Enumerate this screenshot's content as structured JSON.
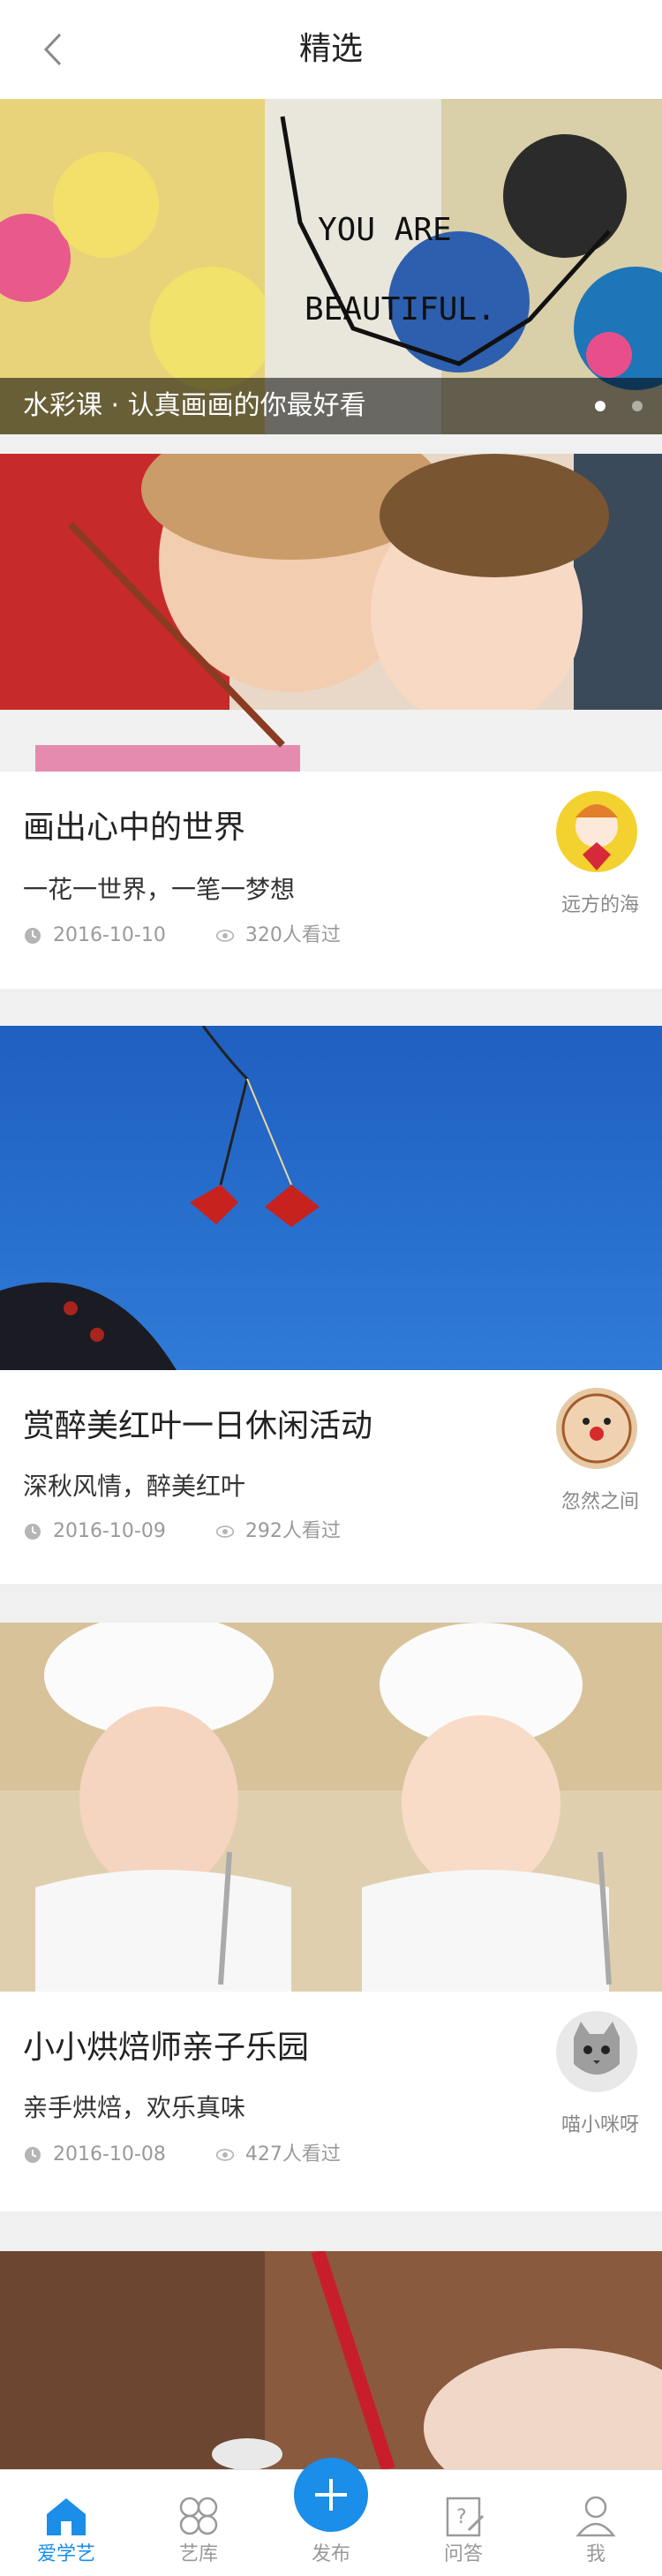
{
  "header": {
    "title": "精选"
  },
  "banner": {
    "caption": "水彩课 · 认真画画的你最好看",
    "art_text_1": "YOU ARE",
    "art_text_2": "BEAUTIFUL."
  },
  "cards": [
    {
      "title": "画出心中的世界",
      "subtitle": "一花一世界，一笔一梦想",
      "date": "2016-10-10",
      "views": "320人看过",
      "author": "远方的海"
    },
    {
      "title": "赏醉美红叶一日休闲活动",
      "subtitle": "深秋风情，醉美红叶",
      "date": "2016-10-09",
      "views": "292人看过",
      "author": "忽然之间"
    },
    {
      "title": "小小烘焙师亲子乐园",
      "subtitle": "亲手烘焙，欢乐真味",
      "date": "2016-10-08",
      "views": "427人看过",
      "author": "喵小咪呀"
    }
  ],
  "tabs": [
    {
      "label": "爱学艺",
      "icon": "home-icon"
    },
    {
      "label": "艺库",
      "icon": "grid-icon"
    },
    {
      "label": "发布",
      "icon": "plus-icon"
    },
    {
      "label": "问答",
      "icon": "question-icon"
    },
    {
      "label": "我",
      "icon": "user-icon"
    }
  ],
  "colors": {
    "accent": "#1a8ee8",
    "meta": "#9a9a9a"
  }
}
